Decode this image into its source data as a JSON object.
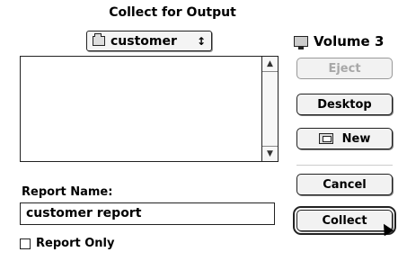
{
  "dialog": {
    "title": "Collect for Output",
    "folder_popup": {
      "selected": "customer",
      "arrows": "↕"
    },
    "volume": {
      "label": "Volume 3"
    },
    "file_list": {
      "items": []
    },
    "report_name": {
      "label": "Report Name:",
      "value": "customer report"
    },
    "report_only": {
      "label": "Report Only",
      "checked": false
    },
    "buttons": {
      "eject": "Eject",
      "desktop": "Desktop",
      "new": "New",
      "cancel": "Cancel",
      "collect": "Collect"
    }
  }
}
